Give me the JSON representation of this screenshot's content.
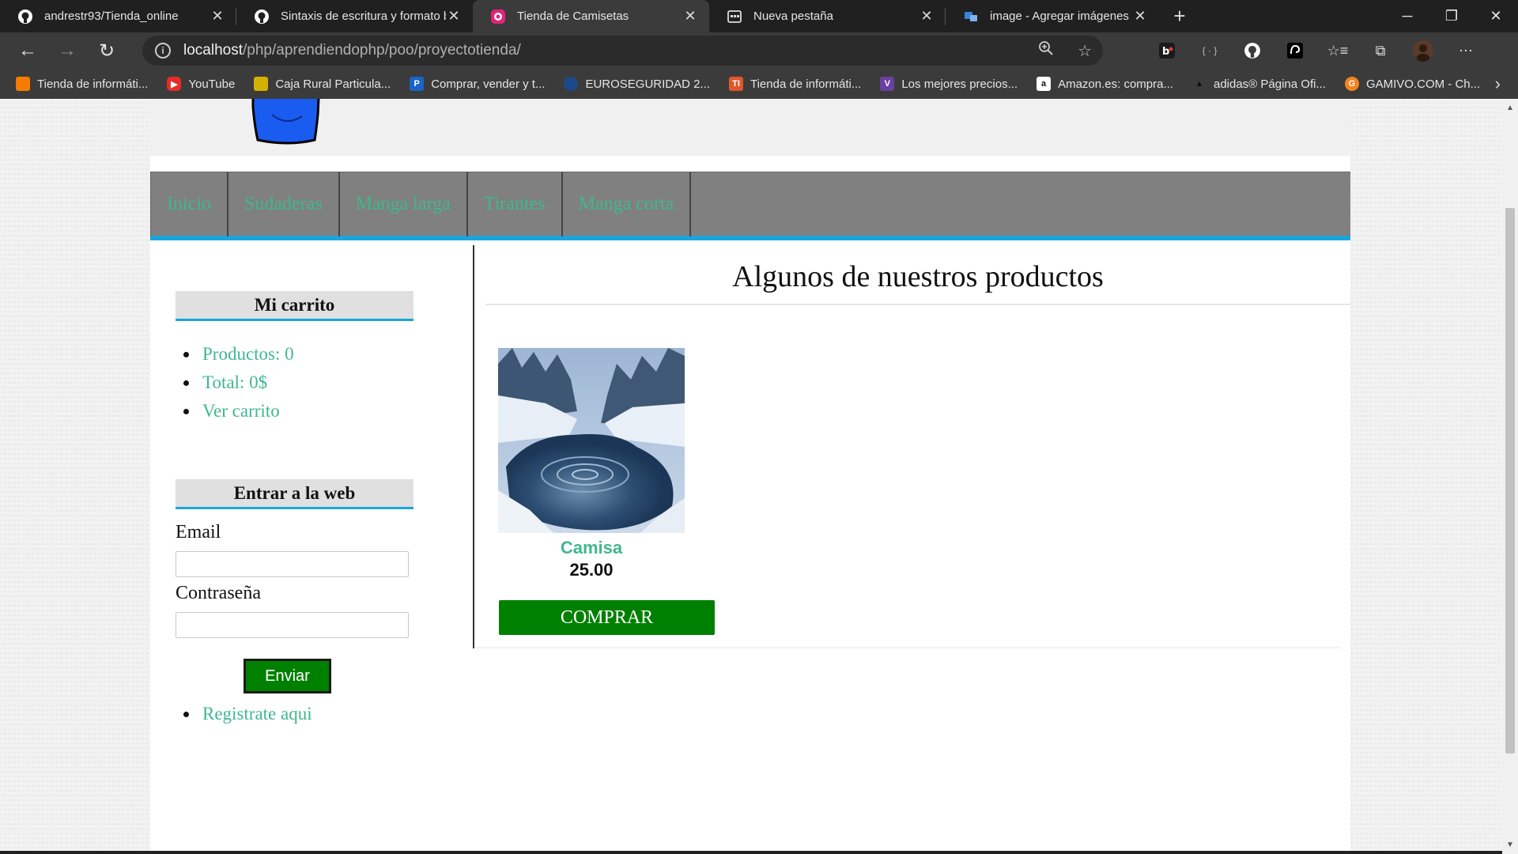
{
  "browser": {
    "tabs": [
      {
        "title": "andrestr93/Tienda_online",
        "icon": "github-icon",
        "active": false
      },
      {
        "title": "Sintaxis de escritura y formato b",
        "icon": "github-icon",
        "active": false
      },
      {
        "title": "Tienda de Camisetas",
        "icon": "shop-icon",
        "active": true
      },
      {
        "title": "Nueva pestaña",
        "icon": "newtab-page-icon",
        "active": false
      },
      {
        "title": "image - Agregar imágenes a REA",
        "icon": "stackoverflow-icon",
        "active": false
      }
    ],
    "close_glyph": "✕",
    "new_tab_glyph": "+",
    "address": {
      "host": "localhost",
      "path": "/php/aprendiendophp/poo/proyectotienda/"
    },
    "bookmarks": [
      {
        "label": "Tienda de informáti...",
        "icon_color": "#f57c00"
      },
      {
        "label": "YouTube",
        "icon_color": "#e52d27"
      },
      {
        "label": "Caja Rural Particula...",
        "icon_color": "#d4b000"
      },
      {
        "label": "Comprar, vender y t...",
        "icon_color": "#1a64c8"
      },
      {
        "label": "EUROSEGURIDAD 2...",
        "icon_color": "#1a4a8a"
      },
      {
        "label": "Tienda de informáti...",
        "icon_color": "#e0572b"
      },
      {
        "label": "Los mejores precios...",
        "icon_color": "#6a3fa0"
      },
      {
        "label": "Amazon.es: compra...",
        "icon_color": "#ffffff"
      },
      {
        "label": "adidas® Página Ofi...",
        "icon_color": "#111111"
      },
      {
        "label": "GAMIVO.COM - Ch...",
        "icon_color": "#f58220"
      }
    ]
  },
  "site": {
    "menu": [
      "Inicio",
      "Sudaderas",
      "Manga larga",
      "Tirantes",
      "Manga corta"
    ],
    "cart": {
      "title": "Mi carrito",
      "items": [
        "Productos: 0",
        "Total: 0$",
        "Ver carrito"
      ]
    },
    "login": {
      "title": "Entrar a la web",
      "email_label": "Email",
      "password_label": "Contraseña",
      "submit_label": "Enviar",
      "register_label": "Registrate aqui"
    },
    "main": {
      "heading": "Algunos de nuestros productos",
      "product": {
        "name": "Camisa",
        "price": "25.00",
        "buy_label": "COMPRAR"
      }
    }
  },
  "colors": {
    "link_green": "#3fb88c",
    "accent_blue": "#1aa6dc",
    "button_green": "#008000",
    "menu_gray": "#808080"
  }
}
